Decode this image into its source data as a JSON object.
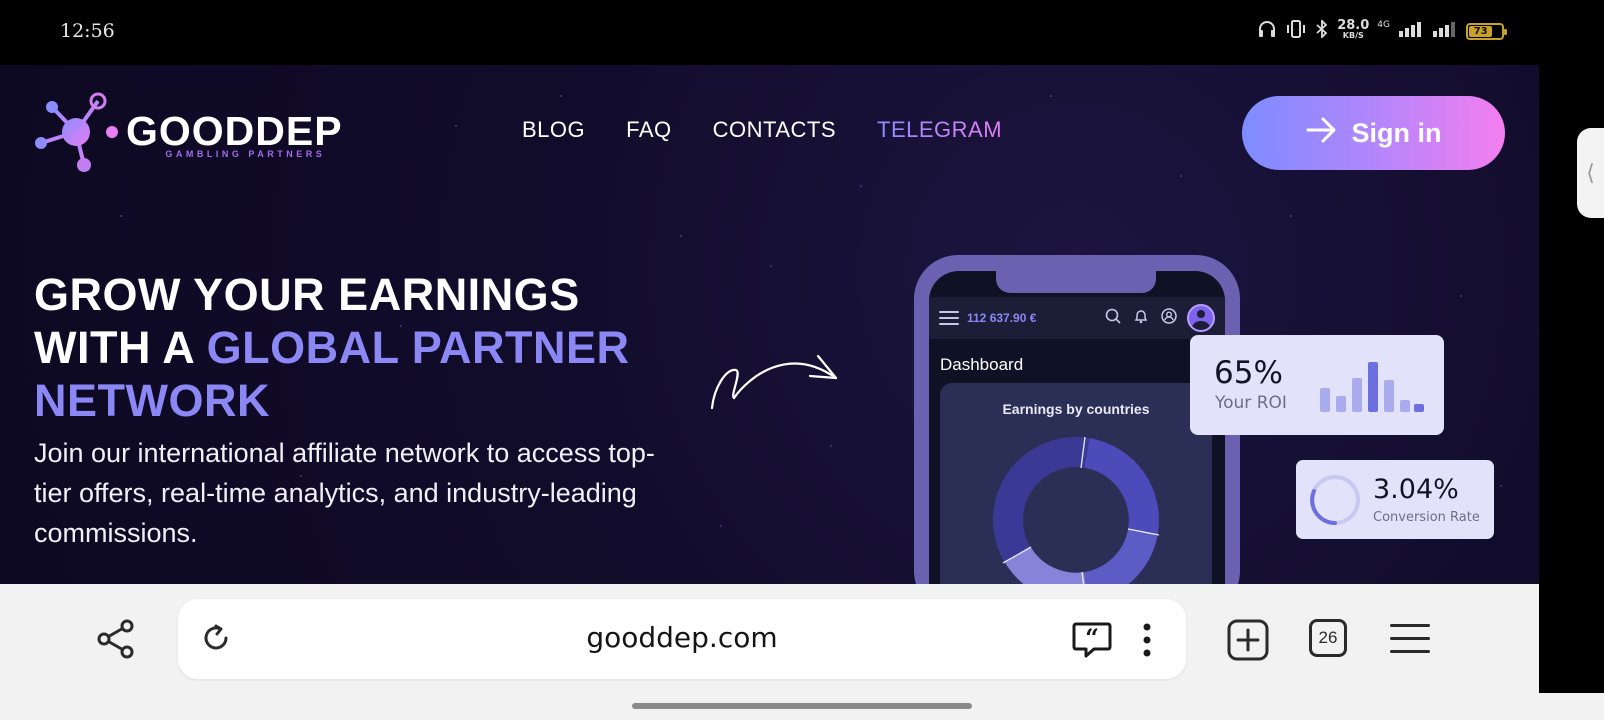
{
  "status_bar": {
    "time": "12:56",
    "speed_value": "28.0",
    "speed_unit": "KB/S",
    "network": "4G",
    "battery": "73"
  },
  "site": {
    "logo": {
      "title": "GOODDEP",
      "subtitle": "GAMBLING PARTNERS"
    },
    "nav": {
      "blog": "BLOG",
      "faq": "FAQ",
      "contacts": "CONTACTS",
      "telegram": "TELEGRAM"
    },
    "signin_label": "Sign in",
    "hero": {
      "line1": "GROW YOUR EARNINGS",
      "line2_plain": "WITH A ",
      "line2_highlight": "GLOBAL PARTNER",
      "line3_highlight": "NETWORK",
      "description": "Join our international affiliate network to access top-tier offers, real-time analytics, and industry-leading commissions."
    },
    "phone": {
      "balance": "112 637.90 €",
      "dashboard_title": "Dashboard",
      "chart_title": "Earnings by countries"
    },
    "roi_card": {
      "value": "65%",
      "label": "Your ROI"
    },
    "conversion_card": {
      "value": "3.04%",
      "label": "Conversion Rate"
    }
  },
  "browser": {
    "url": "gooddep.com",
    "tab_count": "26"
  },
  "colors": {
    "accent_purple": "#8b88f6",
    "signin_gradient_start": "#7d8cff",
    "signin_gradient_end": "#f47ef0",
    "site_background": "#120c2c"
  }
}
